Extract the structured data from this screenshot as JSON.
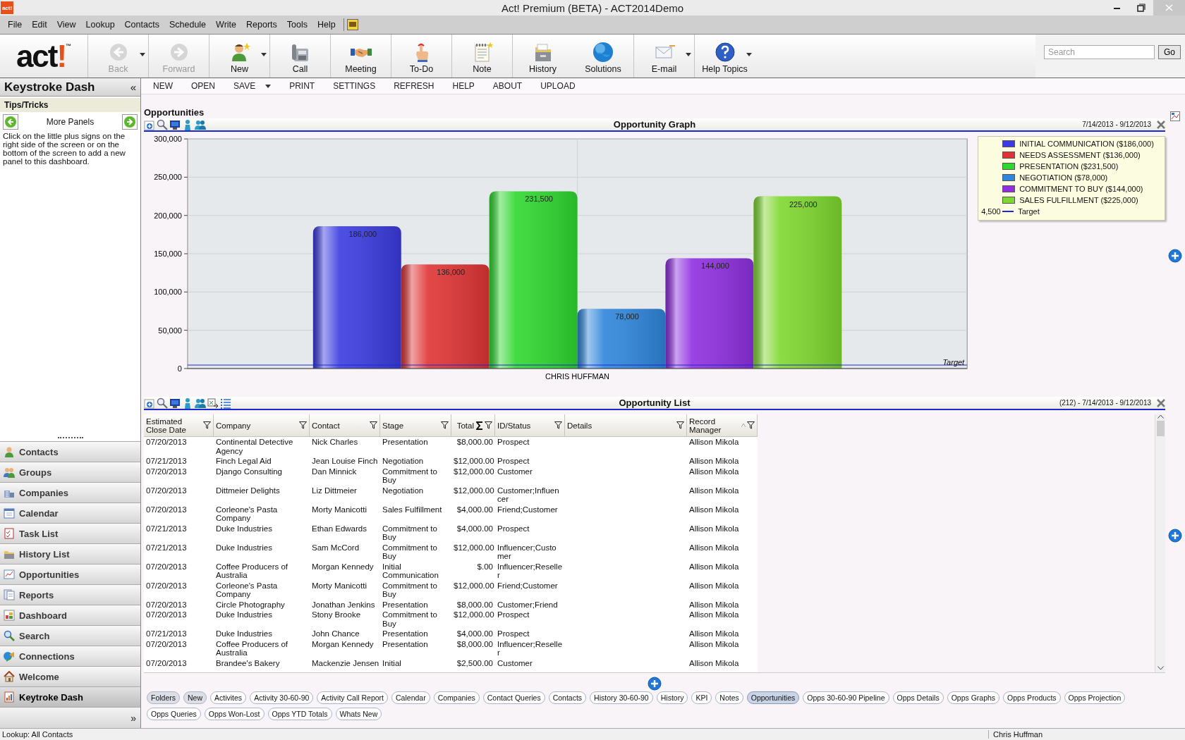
{
  "window": {
    "app_icon": "act!",
    "title": "Act! Premium (BETA) - ACT2014Demo"
  },
  "menu": [
    "File",
    "Edit",
    "View",
    "Lookup",
    "Contacts",
    "Schedule",
    "Write",
    "Reports",
    "Tools",
    "Help"
  ],
  "logo": {
    "word": "act",
    "mark": "!",
    "tm": "™"
  },
  "toolbar": [
    {
      "label": "Back",
      "disabled": true,
      "dropdown": true,
      "separator_before": true
    },
    {
      "label": "Forward",
      "disabled": true,
      "dropdown": false,
      "separator_before": true
    },
    {
      "label": "New",
      "disabled": false,
      "dropdown": true,
      "separator_before": true
    },
    {
      "label": "Call",
      "disabled": false,
      "dropdown": false,
      "separator_before": true
    },
    {
      "label": "Meeting",
      "disabled": false,
      "dropdown": false,
      "separator_before": true
    },
    {
      "label": "To-Do",
      "disabled": false,
      "dropdown": false,
      "separator_before": true
    },
    {
      "label": "Note",
      "disabled": false,
      "dropdown": false,
      "separator_before": true
    },
    {
      "label": "History",
      "disabled": false,
      "dropdown": false,
      "separator_before": true
    },
    {
      "label": "Solutions",
      "disabled": false,
      "dropdown": false,
      "separator_before": false
    },
    {
      "label": "E-mail",
      "disabled": false,
      "dropdown": true,
      "separator_before": true
    },
    {
      "label": "Help Topics",
      "disabled": false,
      "dropdown": true,
      "separator_before": true
    }
  ],
  "search": {
    "placeholder": "Search",
    "button": "Go"
  },
  "sidebar": {
    "title": "Keystroke Dash",
    "collapse": "«",
    "panel_title": "Tips/Tricks",
    "panel_nav": "More Panels",
    "tip": "Click on the little plus signs on the right side of the screen or on the bottom of the screen to add a new panel to this dashboard.",
    "items": [
      {
        "label": "Contacts",
        "selected": false
      },
      {
        "label": "Groups",
        "selected": false
      },
      {
        "label": "Companies",
        "selected": false
      },
      {
        "label": "Calendar",
        "selected": false
      },
      {
        "label": "Task List",
        "selected": false
      },
      {
        "label": "History List",
        "selected": false
      },
      {
        "label": "Opportunities",
        "selected": false
      },
      {
        "label": "Reports",
        "selected": false
      },
      {
        "label": "Dashboard",
        "selected": false
      },
      {
        "label": "Search",
        "selected": false
      },
      {
        "label": "Connections",
        "selected": false
      },
      {
        "label": "Welcome",
        "selected": false
      },
      {
        "label": "Keytroke Dash",
        "selected": true
      }
    ],
    "more": "»"
  },
  "dash_toolbar": [
    {
      "label": "NEW",
      "dropdown": false
    },
    {
      "label": "OPEN",
      "dropdown": false
    },
    {
      "label": "SAVE",
      "dropdown": true
    },
    {
      "label": "PRINT",
      "dropdown": false
    },
    {
      "label": "SETTINGS",
      "dropdown": false
    },
    {
      "label": "REFRESH",
      "dropdown": false
    },
    {
      "label": "HELP",
      "dropdown": false
    },
    {
      "label": "ABOUT",
      "dropdown": false
    },
    {
      "label": "UPLOAD",
      "dropdown": false
    }
  ],
  "page_title": "Opportunities",
  "graph": {
    "title": "Opportunity Graph",
    "date_range": "7/14/2013 - 9/12/2013",
    "chart_data": {
      "type": "bar",
      "categories": [
        "CHRIS HUFFMAN"
      ],
      "series": [
        {
          "name": "INITIAL COMMUNICATION ($186,000)",
          "color": "#3b3be0",
          "values": [
            186000
          ],
          "value_labels": [
            "186,000"
          ]
        },
        {
          "name": "NEEDS ASSESSMENT ($136,000)",
          "color": "#e03434",
          "values": [
            136000
          ],
          "value_labels": [
            "136,000"
          ]
        },
        {
          "name": "PRESENTATION ($231,500)",
          "color": "#2fd82f",
          "values": [
            231500
          ],
          "value_labels": [
            "231,500"
          ]
        },
        {
          "name": "NEGOTIATION ($78,000)",
          "color": "#2f86dc",
          "values": [
            78000
          ],
          "value_labels": [
            "78,000"
          ]
        },
        {
          "name": "COMMITMENT TO BUY ($144,000)",
          "color": "#8f2fe0",
          "values": [
            144000
          ],
          "value_labels": [
            "144,000"
          ]
        },
        {
          "name": "SALES FULFILLMENT ($225,000)",
          "color": "#7fd82f",
          "values": [
            225000
          ],
          "value_labels": [
            "225,000"
          ]
        }
      ],
      "ylim": [
        0,
        300000
      ],
      "yticks": [
        {
          "value": 0,
          "label": "0"
        },
        {
          "value": 50000,
          "label": "50,000"
        },
        {
          "value": 100000,
          "label": "100,000"
        },
        {
          "value": 150000,
          "label": "150,000"
        },
        {
          "value": 200000,
          "label": "200,000"
        },
        {
          "value": 250000,
          "label": "250,000"
        },
        {
          "value": 300000,
          "label": "300,000"
        }
      ],
      "grid": true,
      "ref_lines": [
        {
          "axis": "y",
          "value": 4500,
          "label": "Target",
          "color": "#1a2ad0"
        }
      ]
    },
    "target_legend": {
      "reading": "4,500",
      "label": "Target"
    }
  },
  "list": {
    "title": "Opportunity List",
    "date_range": "(212) - 7/14/2013 - 9/12/2013",
    "columns": [
      {
        "label": "Estimated Close Date",
        "sorted": false
      },
      {
        "label": "Company",
        "sorted": false
      },
      {
        "label": "Contact",
        "sorted": false
      },
      {
        "label": "Stage",
        "sorted": false
      },
      {
        "label": "Total",
        "sorted": false
      },
      {
        "label": "ID/Status",
        "sorted": false
      },
      {
        "label": "Details",
        "sorted": false
      },
      {
        "label": "Record Manager",
        "sorted": true
      }
    ],
    "rows": [
      {
        "close_date": "07/20/2013",
        "company": "Continental Detective Agency",
        "contact": "Nick Charles",
        "stage": "Presentation",
        "total": "$8,000.00",
        "id_status": "Prospect",
        "record_manager": "Allison Mikola"
      },
      {
        "close_date": "07/21/2013",
        "company": "Finch Legal Aid",
        "contact": "Jean Louise Finch",
        "stage": "Negotiation",
        "total": "$12,000.00",
        "id_status": "Prospect",
        "record_manager": "Allison Mikola"
      },
      {
        "close_date": "07/20/2013",
        "company": "Django Consulting",
        "contact": "Dan Minnick",
        "stage": "Commitment to Buy",
        "total": "$12,000.00",
        "id_status": "Customer",
        "record_manager": "Allison Mikola"
      },
      {
        "close_date": "07/20/2013",
        "company": "Dittmeier Delights",
        "contact": "Liz Dittmeier",
        "stage": "Negotiation",
        "total": "$12,000.00",
        "id_status": "Customer;Influencer",
        "record_manager": "Allison Mikola"
      },
      {
        "close_date": "07/20/2013",
        "company": "Corleone's Pasta Company",
        "contact": "Morty Manicotti",
        "stage": "Sales Fulfillment",
        "total": "$4,000.00",
        "id_status": "Friend;Customer",
        "record_manager": "Allison Mikola"
      },
      {
        "close_date": "07/21/2013",
        "company": "Duke Industries",
        "contact": "Ethan Edwards",
        "stage": "Commitment to Buy",
        "total": "$4,000.00",
        "id_status": "Prospect",
        "record_manager": "Allison Mikola"
      },
      {
        "close_date": "07/21/2013",
        "company": "Duke Industries",
        "contact": "Sam McCord",
        "stage": "Commitment to Buy",
        "total": "$12,000.00",
        "id_status": "Influencer;Customer",
        "record_manager": "Allison Mikola"
      },
      {
        "close_date": "07/20/2013",
        "company": "Coffee Producers of Australia",
        "contact": "Morgan Kennedy",
        "stage": "Initial Communication",
        "total": "$.00",
        "id_status": "Influencer;Reseller",
        "record_manager": "Allison Mikola"
      },
      {
        "close_date": "07/20/2013",
        "company": "Corleone's Pasta Company",
        "contact": "Morty Manicotti",
        "stage": "Commitment to Buy",
        "total": "$12,000.00",
        "id_status": "Friend;Customer",
        "record_manager": "Allison Mikola"
      },
      {
        "close_date": "07/20/2013",
        "company": "Circle Photography",
        "contact": "Jonathan Jenkins",
        "stage": "Presentation",
        "total": "$8,000.00",
        "id_status": "Customer;Friend",
        "record_manager": "Allison Mikola"
      },
      {
        "close_date": "07/20/2013",
        "company": "Duke Industries",
        "contact": "Stony Brooke",
        "stage": "Commitment to Buy",
        "total": "$12,000.00",
        "id_status": "Prospect",
        "record_manager": "Allison Mikola"
      },
      {
        "close_date": "07/21/2013",
        "company": "Duke Industries",
        "contact": "John Chance",
        "stage": "Presentation",
        "total": "$4,000.00",
        "id_status": "Prospect",
        "record_manager": "Allison Mikola"
      },
      {
        "close_date": "07/20/2013",
        "company": "Coffee Producers of Australia",
        "contact": "Morgan Kennedy",
        "stage": "Presentation",
        "total": "$8,000.00",
        "id_status": "Influencer;Reseller",
        "record_manager": "Allison Mikola"
      },
      {
        "close_date": "07/20/2013",
        "company": "Brandee's Bakery",
        "contact": "Mackenzie Jensen",
        "stage": "Initial",
        "total": "$2,500.00",
        "id_status": "Customer",
        "record_manager": "Allison Mikola"
      }
    ]
  },
  "tabs": [
    {
      "label": "Folders",
      "kind": "action",
      "selected": false
    },
    {
      "label": "New",
      "kind": "action",
      "selected": false
    },
    {
      "label": "Activites",
      "kind": "panel",
      "selected": false
    },
    {
      "label": "Activity 30-60-90",
      "kind": "panel",
      "selected": false
    },
    {
      "label": "Activity Call Report",
      "kind": "panel",
      "selected": false
    },
    {
      "label": "Calendar",
      "kind": "panel",
      "selected": false
    },
    {
      "label": "Companies",
      "kind": "panel",
      "selected": false
    },
    {
      "label": "Contact Queries",
      "kind": "panel",
      "selected": false
    },
    {
      "label": "Contacts",
      "kind": "panel",
      "selected": false
    },
    {
      "label": "History 30-60-90",
      "kind": "panel",
      "selected": false
    },
    {
      "label": "History",
      "kind": "panel",
      "selected": false
    },
    {
      "label": "KPI",
      "kind": "panel",
      "selected": false
    },
    {
      "label": "Notes",
      "kind": "panel",
      "selected": false
    },
    {
      "label": "Opportunities",
      "kind": "panel",
      "selected": true
    },
    {
      "label": "Opps 30-60-90 Pipeline",
      "kind": "panel",
      "selected": false
    },
    {
      "label": "Opps Details",
      "kind": "panel",
      "selected": false
    },
    {
      "label": "Opps Graphs",
      "kind": "panel",
      "selected": false
    },
    {
      "label": "Opps Products",
      "kind": "panel",
      "selected": false
    },
    {
      "label": "Opps Projection",
      "kind": "panel",
      "selected": false
    },
    {
      "label": "Opps Queries",
      "kind": "panel",
      "selected": false
    },
    {
      "label": "Opps Won-Lost",
      "kind": "panel",
      "selected": false
    },
    {
      "label": "Opps YTD Totals",
      "kind": "panel",
      "selected": false
    },
    {
      "label": "Whats New",
      "kind": "panel",
      "selected": false
    }
  ],
  "status_bar": {
    "left": "Lookup: All Contacts",
    "right": "Chris Huffman"
  }
}
